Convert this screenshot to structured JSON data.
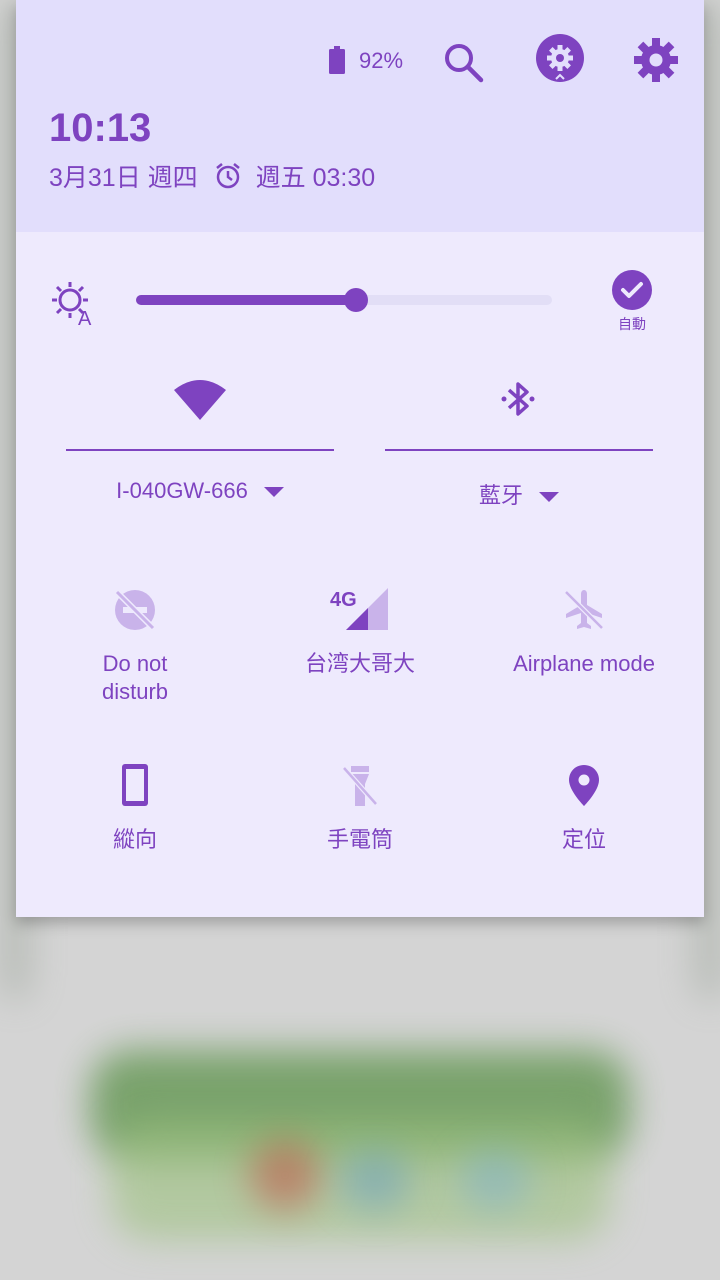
{
  "status": {
    "battery_percent": "92%"
  },
  "header": {
    "time": "10:13",
    "date": "3月31日 週四",
    "alarm": "週五 03:30"
  },
  "brightness": {
    "level": 0.53,
    "auto_label": "自動"
  },
  "wifi": {
    "label": "I-040GW-666"
  },
  "bluetooth": {
    "label": "藍牙"
  },
  "tiles": [
    {
      "label": "Do not disturb"
    },
    {
      "label": "台湾大哥大",
      "badge": "4G"
    },
    {
      "label": "Airplane mode"
    },
    {
      "label": "縱向"
    },
    {
      "label": "手電筒"
    },
    {
      "label": "定位"
    }
  ],
  "colors": {
    "accent": "#7e43c0",
    "header_bg": "#e2defc",
    "panel_bg": "#eeeafd",
    "inactive": "#c9b3ea"
  }
}
